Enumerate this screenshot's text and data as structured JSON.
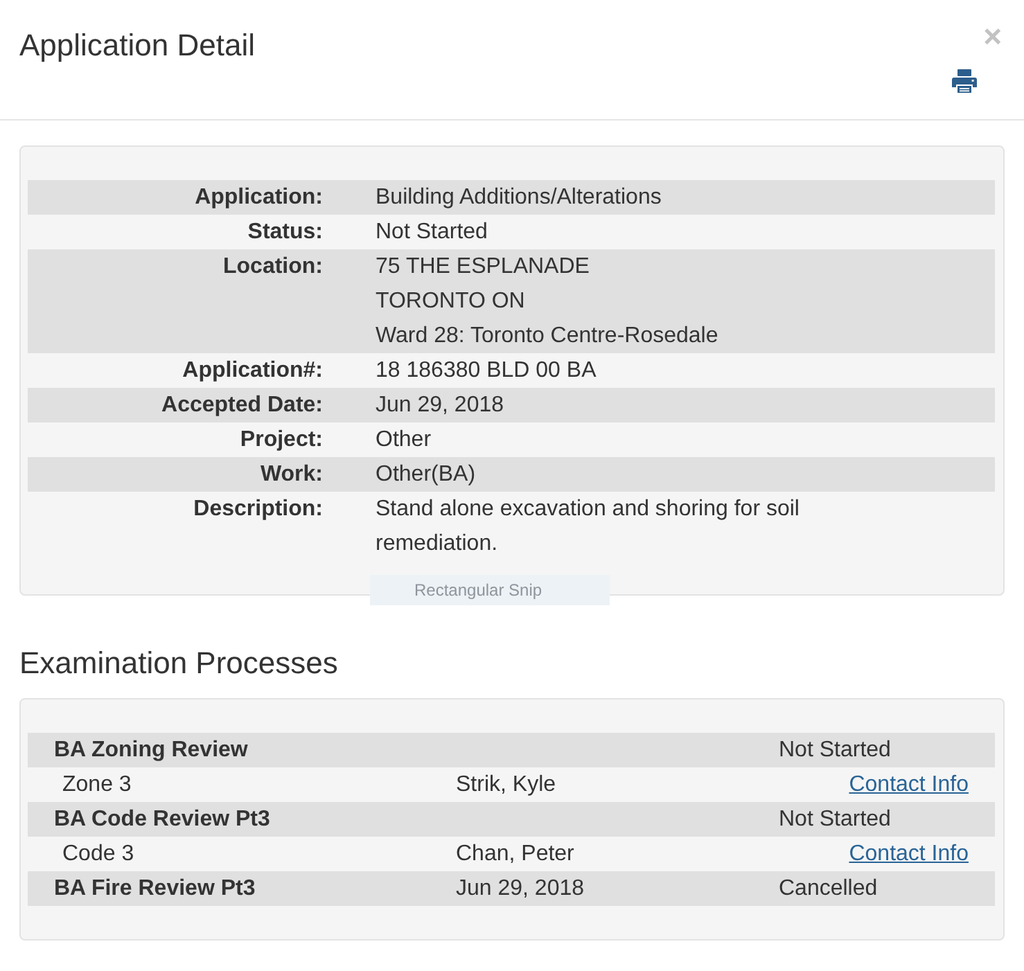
{
  "header": {
    "title": "Application Detail",
    "close_button": {
      "label": "×"
    }
  },
  "details": {
    "rows": [
      {
        "label": "Application:",
        "lines": [
          "Building Additions/Alterations"
        ]
      },
      {
        "label": "Status:",
        "lines": [
          "Not Started"
        ]
      },
      {
        "label": "Location:",
        "lines": [
          "75 THE ESPLANADE",
          "TORONTO ON",
          "Ward 28: Toronto Centre-Rosedale"
        ]
      },
      {
        "label": "Application#:",
        "lines": [
          "18 186380 BLD 00 BA"
        ]
      },
      {
        "label": "Accepted Date:",
        "lines": [
          "Jun 29, 2018"
        ]
      },
      {
        "label": "Project:",
        "lines": [
          "Other"
        ]
      },
      {
        "label": "Work:",
        "lines": [
          "Other(BA)"
        ]
      },
      {
        "label": "Description:",
        "lines": [
          "Stand alone excavation and shoring for soil remediation."
        ]
      }
    ]
  },
  "snip_tooltip": {
    "label": "Rectangular Snip"
  },
  "examination": {
    "heading": "Examination Processes",
    "processes": [
      {
        "name": "BA Zoning Review",
        "status": "Not Started",
        "tasks": [
          {
            "name": "Zone 3",
            "assignee": "Strik, Kyle",
            "link": "Contact Info"
          }
        ]
      },
      {
        "name": "BA Code Review Pt3",
        "status": "Not Started",
        "tasks": [
          {
            "name": "Code 3",
            "assignee": "Chan, Peter",
            "link": "Contact Info"
          }
        ]
      },
      {
        "name": "BA Fire Review Pt3",
        "date": "Jun 29, 2018",
        "status": "Cancelled"
      }
    ]
  }
}
